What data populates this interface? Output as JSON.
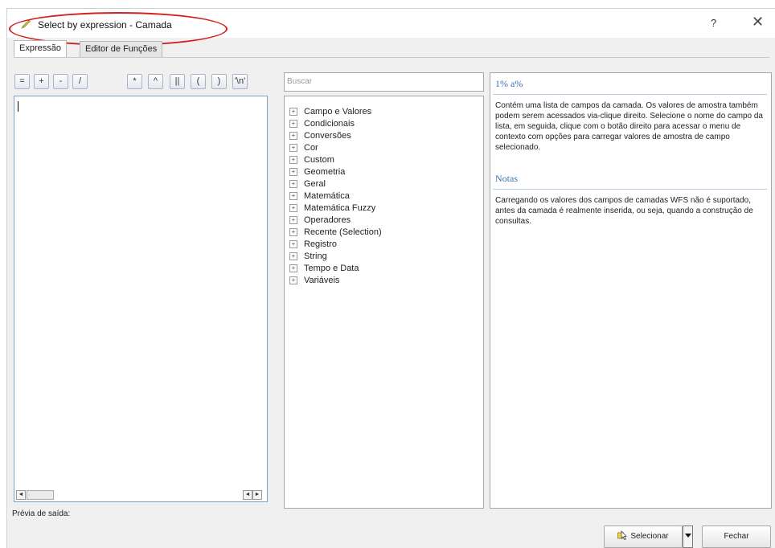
{
  "window": {
    "title": "Select by expression - Camada",
    "help_glyph": "?",
    "close_glyph": "✕"
  },
  "tabs": [
    {
      "label": "Expressão",
      "active": true
    },
    {
      "label": "Editor de Funções",
      "active": false
    }
  ],
  "operators": [
    "=",
    "+",
    "-",
    "/",
    "*",
    "^",
    "||",
    "(",
    ")",
    "'\\n'"
  ],
  "search": {
    "placeholder": "Buscar",
    "value": ""
  },
  "function_groups": [
    "Campo e Valores",
    "Condicionais",
    "Conversões",
    "Cor",
    "Custom",
    "Geometria",
    "Geral",
    "Matemática",
    "Matemática Fuzzy",
    "Operadores",
    "Recente (Selection)",
    "Registro",
    "String",
    "Tempo e Data",
    "Variáveis"
  ],
  "expand_glyph": "+",
  "help_panel": {
    "title": "1% a%",
    "description": "Contém uma lista de campos da camada. Os valores de amostra também podem serem acessados via-clique direito. Selecione o nome do campo da lista, em seguida, clique com o botão direito para acessar o menu de contexto com opções para carregar valores de amostra de campo selecionado.",
    "notes_title": "Notas",
    "notes_text": "Carregando os valores dos campos de camadas WFS não é suportado, antes da camada é realmente inserida, ou seja, quando a construção de consultas."
  },
  "preview_label": "Prévia de saída:",
  "buttons": {
    "select": "Selecionar",
    "close": "Fechar"
  },
  "scroll": {
    "left_glyph": "◄",
    "right_glyph": "►"
  },
  "colors": {
    "highlight": "#d42020",
    "help_heading": "#3c6fb4"
  }
}
